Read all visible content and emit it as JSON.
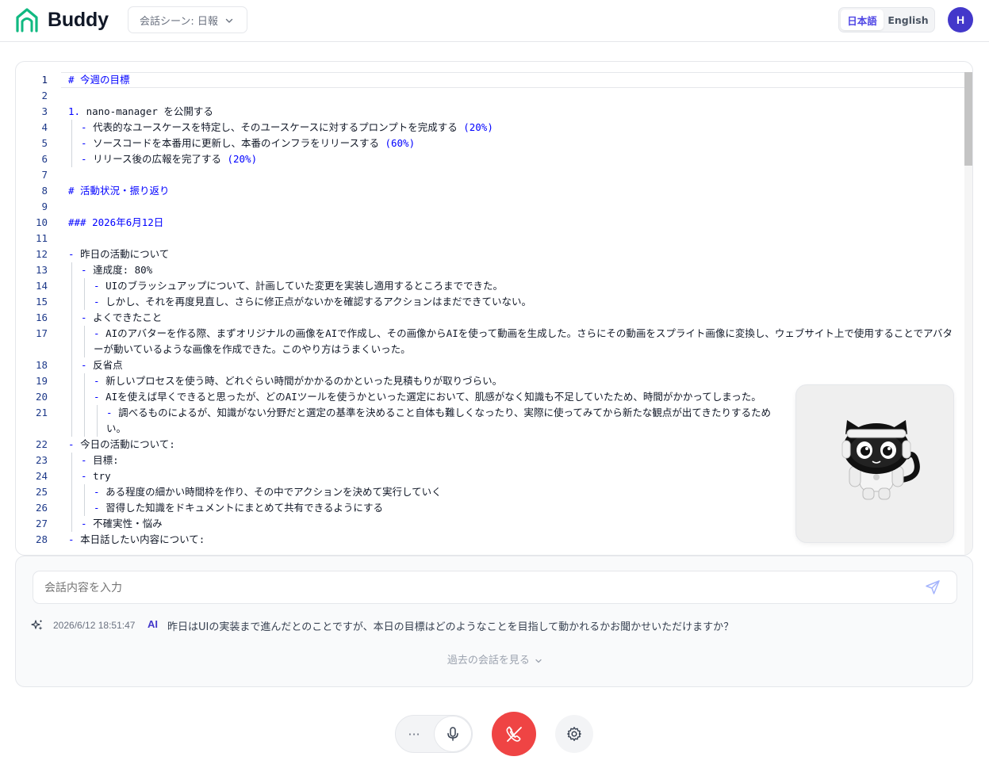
{
  "header": {
    "app_name": "Buddy",
    "scene_select": {
      "value": "会話シーン: 日報"
    },
    "language": {
      "options": [
        "日本語",
        "English"
      ],
      "selected": "日本語"
    },
    "avatar_initial": "H"
  },
  "editor": {
    "lines": [
      {
        "num": "1",
        "text": "# 今週の目標"
      },
      {
        "num": "2",
        "text": ""
      },
      {
        "num": "3",
        "text": "1. nano-manager を公開する"
      },
      {
        "num": "4",
        "text": "- 代表的なユースケースを特定し、そのユースケースに対するプロンプトを完成する (20%)"
      },
      {
        "num": "5",
        "text": "- ソースコードを本番用に更新し、本番のインフラをリリースする (60%)"
      },
      {
        "num": "6",
        "text": "- リリース後の広報を完了する (20%)"
      },
      {
        "num": "7",
        "text": ""
      },
      {
        "num": "8",
        "text": "# 活動状況・振り返り"
      },
      {
        "num": "9",
        "text": ""
      },
      {
        "num": "10",
        "text": "### 2026年6月12日"
      },
      {
        "num": "11",
        "text": ""
      },
      {
        "num": "12",
        "text": "- 昨日の活動について"
      },
      {
        "num": "13",
        "text": "- 達成度: 80%"
      },
      {
        "num": "14",
        "text": "- UIのブラッシュアップについて、計画していた変更を実装し適用するところまでできた。"
      },
      {
        "num": "15",
        "text": "- しかし、それを再度見直し、さらに修正点がないかを確認するアクションはまだできていない。"
      },
      {
        "num": "16",
        "text": "- よくできたこと"
      },
      {
        "num": "17",
        "text": "- AIのアバターを作る際、まずオリジナルの画像をAIで作成し、その画像からAIを使って動画を生成した。さらにその動画をスプライト画像に変換し、ウェブサイト上で使用することでアバターが動いているような画像を作成できた。このやり方はうまくいった。"
      },
      {
        "num": "18",
        "text": "- 反省点"
      },
      {
        "num": "19",
        "text": "- 新しいプロセスを使う時、どれぐらい時間がかかるのかといった見積もりが取りづらい。"
      },
      {
        "num": "20",
        "text": "- AIを使えば早くできると思ったが、どのAIツールを使うかといった選定において、肌感がなく知識も不足していたため、時間がかかってしまった。"
      },
      {
        "num": "21",
        "text": "- 調べるものによるが、知識がない分野だと選定の基準を決めること自体も難しくなったり、実際に使ってみてから新たな観点が出てきたりするため"
      },
      {
        "num": "22",
        "text": "- 今日の活動について:"
      },
      {
        "num": "23",
        "text": "- 目標:"
      },
      {
        "num": "24",
        "text": "- try"
      },
      {
        "num": "25",
        "text": "- ある程度の細かい時間枠を作り、その中でアクションを決めて実行していく"
      },
      {
        "num": "26",
        "text": "- 習得した知識をドキュメントにまとめて共有できるようにする"
      },
      {
        "num": "27",
        "text": "- 不確実性・悩み"
      },
      {
        "num": "28",
        "text": "- 本日話したい内容について:"
      }
    ],
    "line21_wrap": "い。"
  },
  "chat": {
    "input_placeholder": "会話内容を入力",
    "messages": [
      {
        "time": "2026/6/12 18:51:47",
        "role": "AI",
        "text": "昨日はUIの実装まで進んだとのことですが、本日の目標はどのようなことを目指して動かれるかお聞かせいただけますか？"
      }
    ],
    "history_label": "過去の会話を見る"
  },
  "controls": {
    "more_label": "···"
  },
  "colors": {
    "accent": "#4f46e5",
    "heading": "#0000ff",
    "end_call": "#ef4444",
    "logo": "#10b981"
  }
}
